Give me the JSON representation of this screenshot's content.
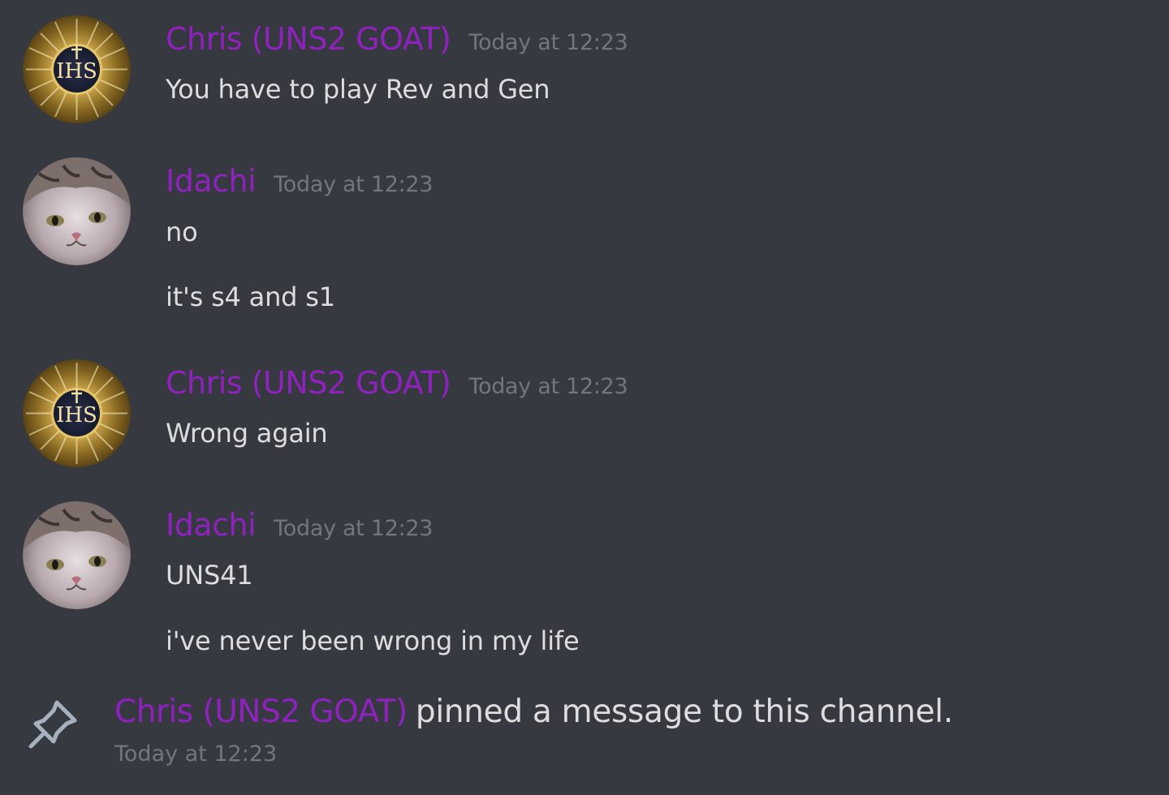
{
  "messages": [
    {
      "author": "Chris (UNS2 GOAT)",
      "avatar_icon": "ihs-emblem-icon",
      "timestamp": "Today at 12:23",
      "lines": [
        "You have to play Rev and Gen"
      ]
    },
    {
      "author": "Idachi",
      "avatar_icon": "cat-avatar-icon",
      "timestamp": "Today at 12:23",
      "lines": [
        "no",
        "it's s4 and s1"
      ]
    },
    {
      "author": "Chris (UNS2 GOAT)",
      "avatar_icon": "ihs-emblem-icon",
      "timestamp": "Today at 12:23",
      "lines": [
        "Wrong again"
      ]
    },
    {
      "author": "Idachi",
      "avatar_icon": "cat-avatar-icon",
      "timestamp": "Today at 12:23",
      "lines": [
        "UNS41",
        "i've never been wrong in my life"
      ]
    }
  ],
  "system_message": {
    "icon": "pin-icon",
    "author": "Chris (UNS2 GOAT)",
    "text": "pinned a message to this channel.",
    "timestamp": "Today at 12:23"
  },
  "colors": {
    "background": "#36393f",
    "username": "#8f21bf",
    "message_text": "#dcddde",
    "timestamp": "#72767d"
  }
}
